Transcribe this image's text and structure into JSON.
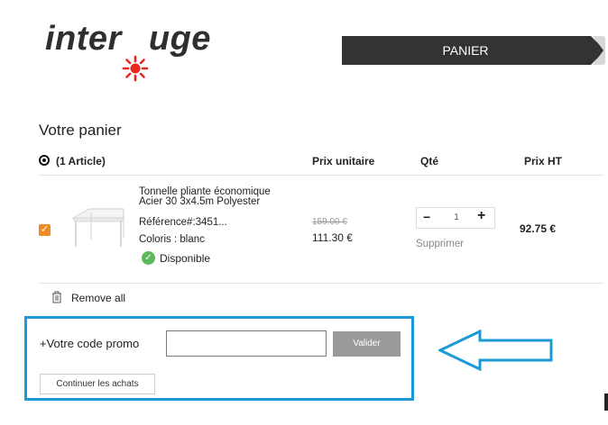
{
  "brand": {
    "logo_text_left": "inter",
    "logo_text_right": "uge"
  },
  "header": {
    "step_label": "PANIER"
  },
  "cart": {
    "title": "Votre panier",
    "article_count": "(1 Article)",
    "columns": {
      "unit_price": "Prix unitaire",
      "qty": "Qté",
      "total": "Prix HT"
    },
    "item": {
      "name": "Tonnelle pliante économique Acier 30 3x4.5m Polyester",
      "reference": "Référence#:3451...",
      "color": "Coloris : blanc",
      "availability": "Disponible",
      "old_price": "159.00 €",
      "price": "111.30 €",
      "quantity": "1",
      "qty_minus": "−",
      "qty_plus": "+",
      "remove_label": "Supprimer",
      "total": "92.75 €"
    },
    "remove_all": "Remove all"
  },
  "promo": {
    "label": "+Votre code promo",
    "input_value": "",
    "submit_label": "Valider"
  },
  "continue_label": "Continuer les achats",
  "colors": {
    "orange": "#f08a24",
    "blue_highlight": "#1b9ad6",
    "green": "#5cb85c",
    "header_dark": "#333333"
  }
}
